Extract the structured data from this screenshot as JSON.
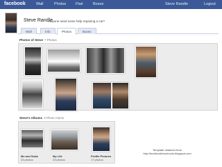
{
  "topbar": {
    "brand": "facebook",
    "nav": [
      "Wall",
      "Photos",
      "Flair",
      "Boxes"
    ],
    "user": "Steve Randle",
    "logout": "Logout"
  },
  "profile": {
    "name": "Steve Randle",
    "status": "Anyone need some help repairing a car?"
  },
  "tabs": [
    "Wall",
    "Info",
    "Photos",
    "Boxes"
  ],
  "active_tab": "Photos",
  "photos": {
    "title": "Photos of Steve",
    "count": "7 Photos"
  },
  "albums": {
    "title": "Steve's Albums",
    "count": "3 Photo Alums",
    "items": [
      {
        "name": "Me and Soda",
        "count": "33 photos"
      },
      {
        "name": "My Life",
        "count": "23 photos"
      },
      {
        "name": "Profile Pictures",
        "count": "17 photos"
      }
    ]
  },
  "credit": {
    "line1": "Template obtained from",
    "line2": "http://techbookforschools.blogspot.com"
  },
  "colors": {
    "topbar": "#3b5998",
    "panel": "#ececec",
    "tab_inactive": "#e4e8f1"
  }
}
